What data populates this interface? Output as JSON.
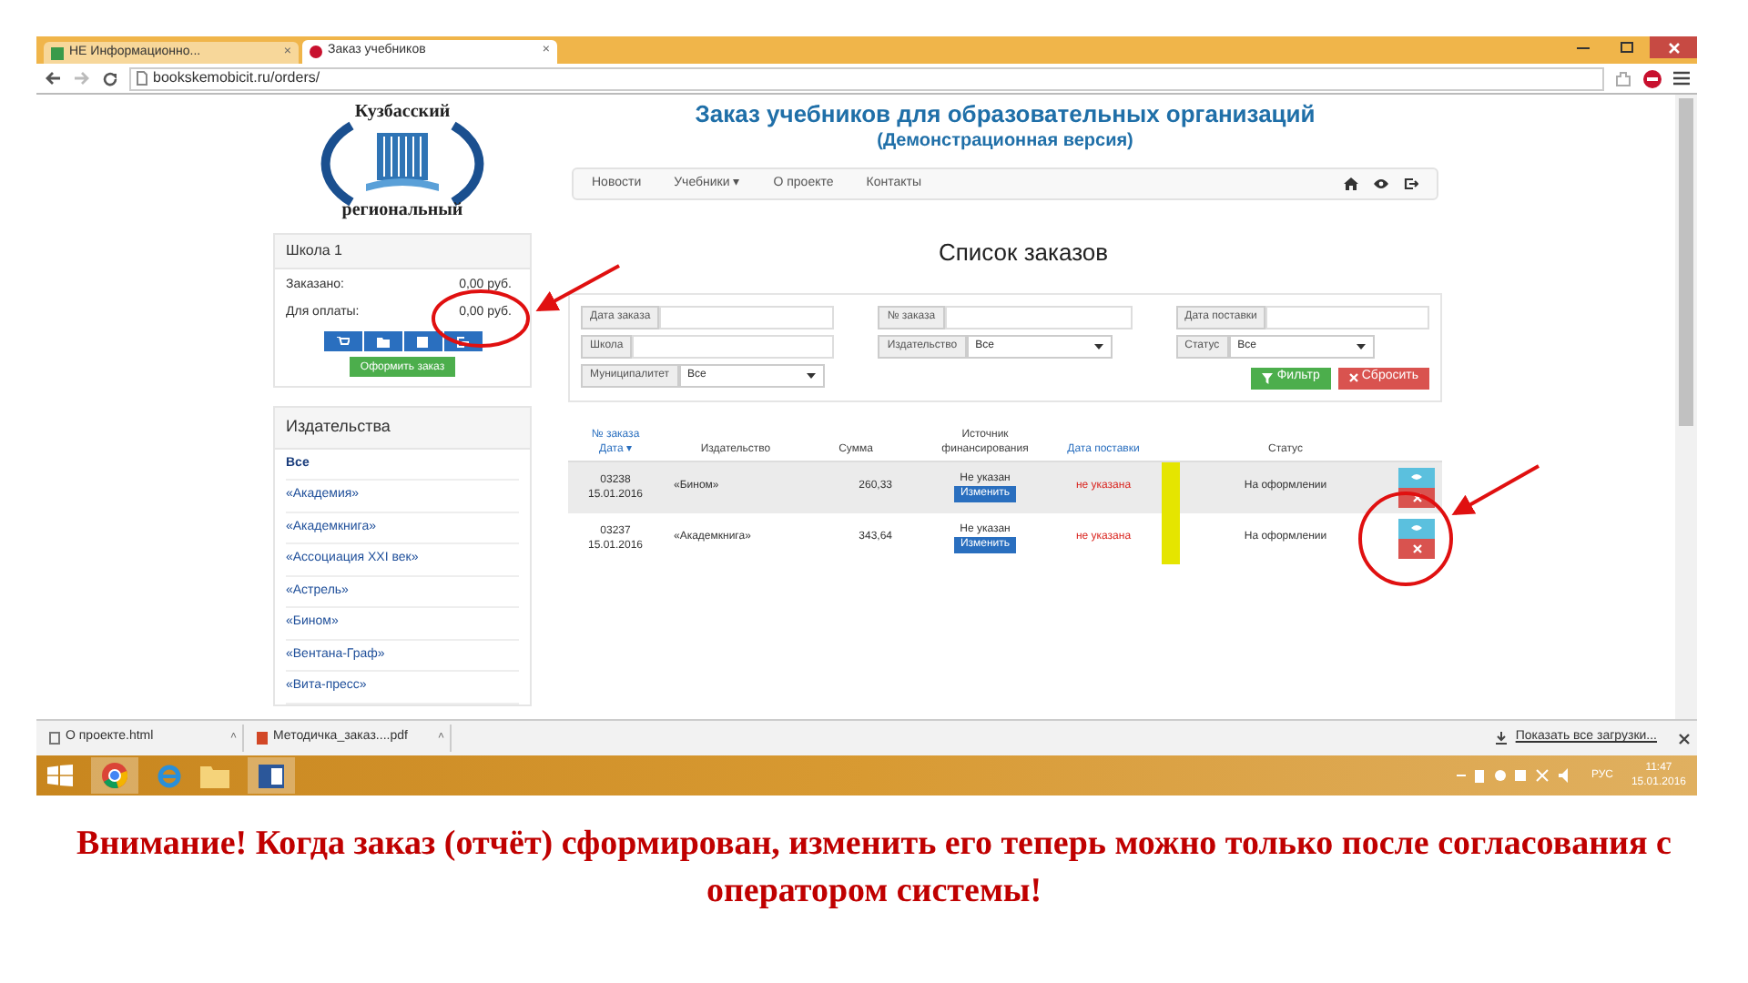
{
  "browser": {
    "tabs": [
      {
        "label": "НЕ Информационно...",
        "close": "×",
        "selected": false
      },
      {
        "label": "Заказ учебников",
        "close": "×",
        "selected": true
      }
    ],
    "url": "bookskemobicit.ru/orders/"
  },
  "logo": {
    "top_text": "Кузбасский",
    "bottom_text": "региональный"
  },
  "header": {
    "title": "Заказ учебников для образовательных организаций",
    "subtitle": "(Демонстрационная версия)"
  },
  "nav": [
    "Новости",
    "Учебники ▾",
    "О проекте",
    "Контакты"
  ],
  "school_panel": {
    "title": "Школа 1",
    "lines": [
      {
        "label": "Заказано:",
        "value": "0,00 руб."
      },
      {
        "label": "Для оплаты:",
        "value": "0,00 руб."
      }
    ],
    "submit": "Оформить заказ"
  },
  "publishers": {
    "title": "Издательства",
    "items": [
      {
        "label": "Все",
        "selected": true
      },
      {
        "label": "«Академия»",
        "selected": false
      },
      {
        "label": "«Академкнига»",
        "selected": false
      },
      {
        "label": "«Ассоциация XXI век»",
        "selected": false
      },
      {
        "label": "«Астрель»",
        "selected": false
      },
      {
        "label": "«Бином»",
        "selected": false
      },
      {
        "label": "«Вентана-Граф»",
        "selected": false
      },
      {
        "label": "«Вита-пресс»",
        "selected": false
      }
    ]
  },
  "orders_title": "Список заказов",
  "filters": [
    {
      "kind": "text",
      "label": "Дата заказа"
    },
    {
      "kind": "text",
      "label": "№ заказа"
    },
    {
      "kind": "text",
      "label": "Дата поставки"
    },
    {
      "kind": "text",
      "label": "Школа"
    },
    {
      "kind": "select",
      "label": "Издательство",
      "value": "Все"
    },
    {
      "kind": "select",
      "label": "Статус",
      "value": "Все"
    },
    {
      "kind": "select",
      "label": "Муниципалитет",
      "value": "Все"
    }
  ],
  "filter_buttons": [
    "Фильтр",
    "Сбросить"
  ],
  "table": {
    "columns": [
      {
        "top": "№ заказа",
        "label": "Дата ▾"
      },
      {
        "label": "Издательство"
      },
      {
        "label": "Сумма"
      },
      {
        "label": "Источник финансирования"
      },
      {
        "label": "Дата поставки"
      },
      {
        "label": "Статус"
      }
    ],
    "rows": [
      {
        "number": "03238",
        "date": "15.01.2016",
        "publisher": "«Бином»",
        "sum": "260,33",
        "source": "Не указан",
        "change": "Изменить",
        "delivery": "не указана",
        "status": "На оформлении",
        "selected": true
      },
      {
        "number": "03237",
        "date": "15.01.2016",
        "publisher": "«Академкнига»",
        "sum": "343,64",
        "source": "Не указан",
        "change": "Изменить",
        "delivery": "не указана",
        "status": "На оформлении",
        "selected": false
      }
    ]
  },
  "downloads": {
    "items": [
      {
        "name": "О проекте.html",
        "menu": "˄"
      },
      {
        "name": "Методичка_заказ....pdf",
        "menu": "˄"
      }
    ],
    "show_all": "Показать все загрузки..."
  },
  "taskbar": {
    "language": "РУС",
    "time": "11:47",
    "date": "15.01.2016"
  },
  "caption": "Внимание! Когда заказ (отчёт) сформирован, изменить его теперь можно только после согласования с оператором системы!"
}
